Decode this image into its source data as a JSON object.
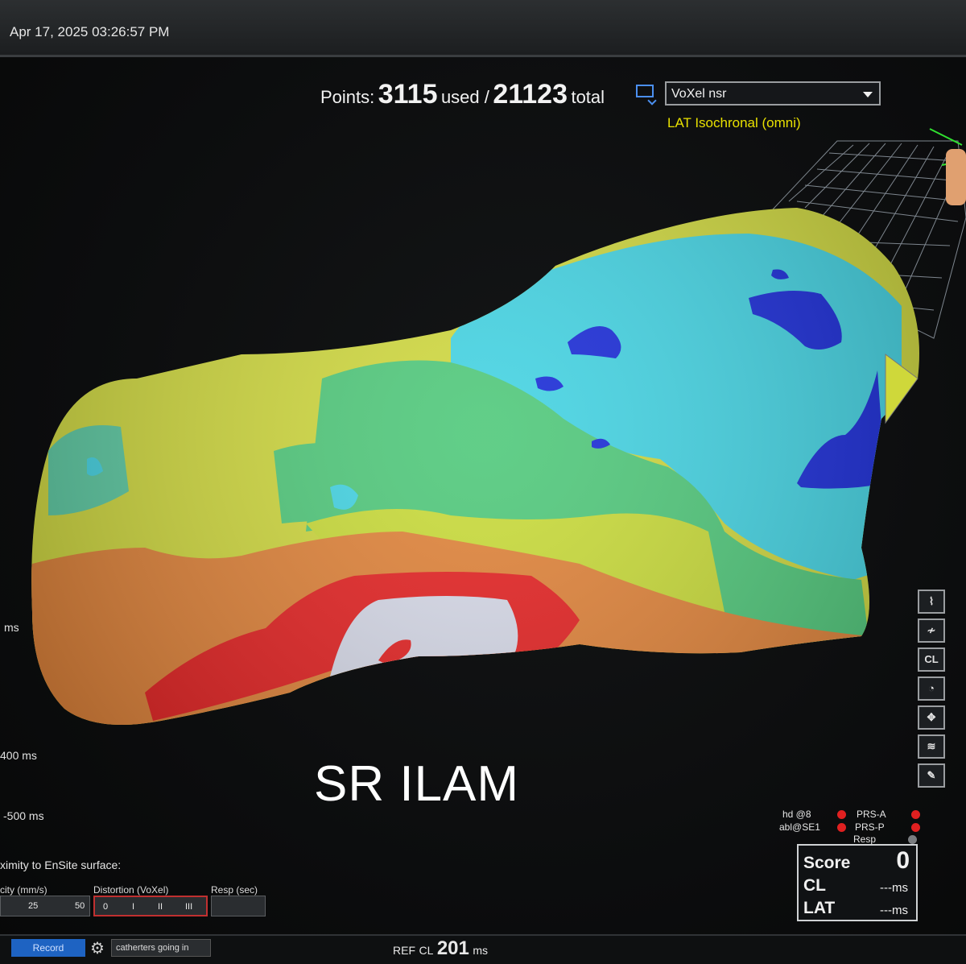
{
  "timestamp": "Apr 17, 2025 03:26:57 PM",
  "points": {
    "label": "Points:",
    "used": "3115",
    "used_label": "used /",
    "total": "21123",
    "total_label": "total"
  },
  "map_selector": {
    "value": "VoXel nsr"
  },
  "map_type": "LAT Isochronal (omni)",
  "caption": "SR ILAM",
  "scale_labels": {
    "ms": "ms",
    "minus400": "400 ms",
    "minus500": "-500 ms"
  },
  "proximity": {
    "title": "ximity to EnSite surface:",
    "velocity_label": "city (mm/s)",
    "velocity_values": [
      "25",
      "50"
    ],
    "distortion_label": "Distortion (VoXel)",
    "distortion_values": [
      "0",
      "I",
      "II",
      "III"
    ],
    "resp_label": "Resp (sec)"
  },
  "bottom": {
    "record_label": "Record",
    "status_text": "catherters going in",
    "ref_label": "REF",
    "cl_label": "CL",
    "cl_value": "201",
    "cl_unit": "ms"
  },
  "catheters": {
    "hd": "hd @8",
    "abl": "abl@SE1",
    "prs_a": "PRS-A",
    "prs_p": "PRS-P",
    "resp": "Resp"
  },
  "score_panel": {
    "score_label": "Score",
    "score_value": "0",
    "cl_label": "CL",
    "cl_value": "---ms",
    "lat_label": "LAT",
    "lat_value": "---ms"
  },
  "toolbar": {
    "cl_button": "CL"
  },
  "colors": {
    "map_yellow": "#d7de3a",
    "map_cyan": "#38d4e6",
    "map_green": "#52c97a",
    "map_blue": "#1426d8",
    "map_orange": "#e07a2a",
    "map_red": "#e31a1a",
    "map_white": "#d6d9e6",
    "label_yellow": "#e8e000",
    "record_blue": "#1e63c2"
  }
}
